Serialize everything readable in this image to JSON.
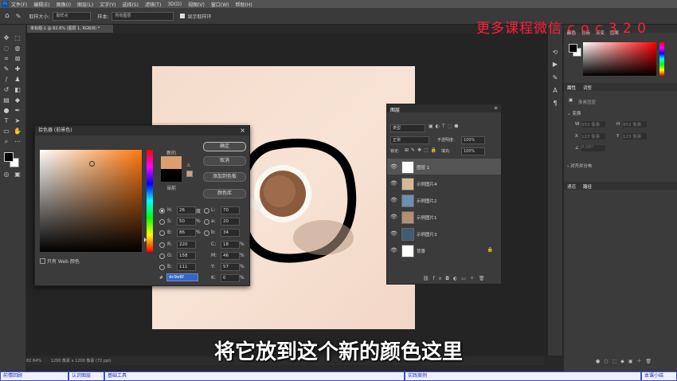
{
  "menubar": {
    "items": [
      "文件(F)",
      "编辑(E)",
      "图像(I)",
      "图层(L)",
      "文字(Y)",
      "选择(S)",
      "滤镜(T)",
      "3D(D)",
      "视图(V)",
      "窗口(W)",
      "帮助(H)"
    ]
  },
  "optionsbar": {
    "sample_size_label": "取样大小:",
    "sample_size_value": "取样点",
    "sample_label": "样本:",
    "sample_value": "所有图层",
    "show_ring_label": "显示取样环"
  },
  "document": {
    "tab_title": "未标题-1 @ 82.6% (图层 1, RGB/8) *"
  },
  "color_picker": {
    "title": "拾色器 (前景色)",
    "new_label": "新的",
    "current_label": "当前",
    "new_color": "#dc9e6f",
    "current_color": "#000000",
    "buttons": {
      "ok": "确定",
      "cancel": "取消",
      "add_swatch": "添加到色板",
      "libraries": "颜色库"
    },
    "web_only_label": "只有 Web 颜色",
    "fields": {
      "H": {
        "label": "H:",
        "value": "26",
        "unit": "度"
      },
      "S": {
        "label": "S:",
        "value": "50",
        "unit": "%"
      },
      "B": {
        "label": "B:",
        "value": "86",
        "unit": "%"
      },
      "R": {
        "label": "R:",
        "value": "220"
      },
      "G": {
        "label": "G:",
        "value": "158"
      },
      "Bl": {
        "label": "B:",
        "value": "111"
      },
      "L": {
        "label": "L:",
        "value": "70"
      },
      "a": {
        "label": "a:",
        "value": "20"
      },
      "b": {
        "label": "b:",
        "value": "34"
      },
      "C": {
        "label": "C:",
        "value": "18",
        "unit": "%"
      },
      "M": {
        "label": "M:",
        "value": "46",
        "unit": "%"
      },
      "Y": {
        "label": "Y:",
        "value": "57",
        "unit": "%"
      },
      "K": {
        "label": "K:",
        "value": "0",
        "unit": "%"
      }
    },
    "hex_label": "#",
    "hex_value": "dc9e6f"
  },
  "layers_panel": {
    "title": "图层",
    "search_placeholder": "类型",
    "blend_mode": "正常",
    "opacity_label": "不透明度:",
    "opacity_value": "100%",
    "lock_label": "锁定:",
    "fill_label": "填充:",
    "fill_value": "100%",
    "layers": [
      {
        "name": "图层 1",
        "selected": true
      },
      {
        "name": "示例图片4",
        "selected": false
      },
      {
        "name": "示例图片2",
        "selected": false
      },
      {
        "name": "示例图片1",
        "selected": false
      },
      {
        "name": "示例图片3",
        "selected": false
      },
      {
        "name": "背景",
        "selected": false
      }
    ]
  },
  "right_panel": {
    "color_tabs": [
      "颜色",
      "色板",
      "渐变",
      "图案"
    ],
    "props_tabs": [
      "属性",
      "调整"
    ],
    "props_doc_label": "像素图层",
    "transform_label": "变换",
    "w_label": "W",
    "w_value": "953 像素",
    "h_label": "H",
    "h_value": "953 像素",
    "x_label": "X",
    "x_value": "123 像素",
    "y_label": "Y",
    "y_value": "123 像素",
    "angle_value": "0.00°",
    "align_label": "对齐并分布",
    "channel_tabs": [
      "通道",
      "路径"
    ]
  },
  "statusbar": {
    "zoom": "82.64%",
    "info": "1200 像素 x 1200 像素 (72 ppi)"
  },
  "chapter_bar": {
    "items": [
      "前情回顾",
      "认识图层",
      "基础工具",
      "实践案例",
      "本课小结"
    ]
  },
  "subtitle": "将它放到这个新的颜色这里",
  "watermark": "更多课程微信 c o c 3 2 0",
  "colors": {
    "accent": "#dc9e6f",
    "chapter_border": "#3a4fd0",
    "watermark": "#ff1e3c"
  }
}
